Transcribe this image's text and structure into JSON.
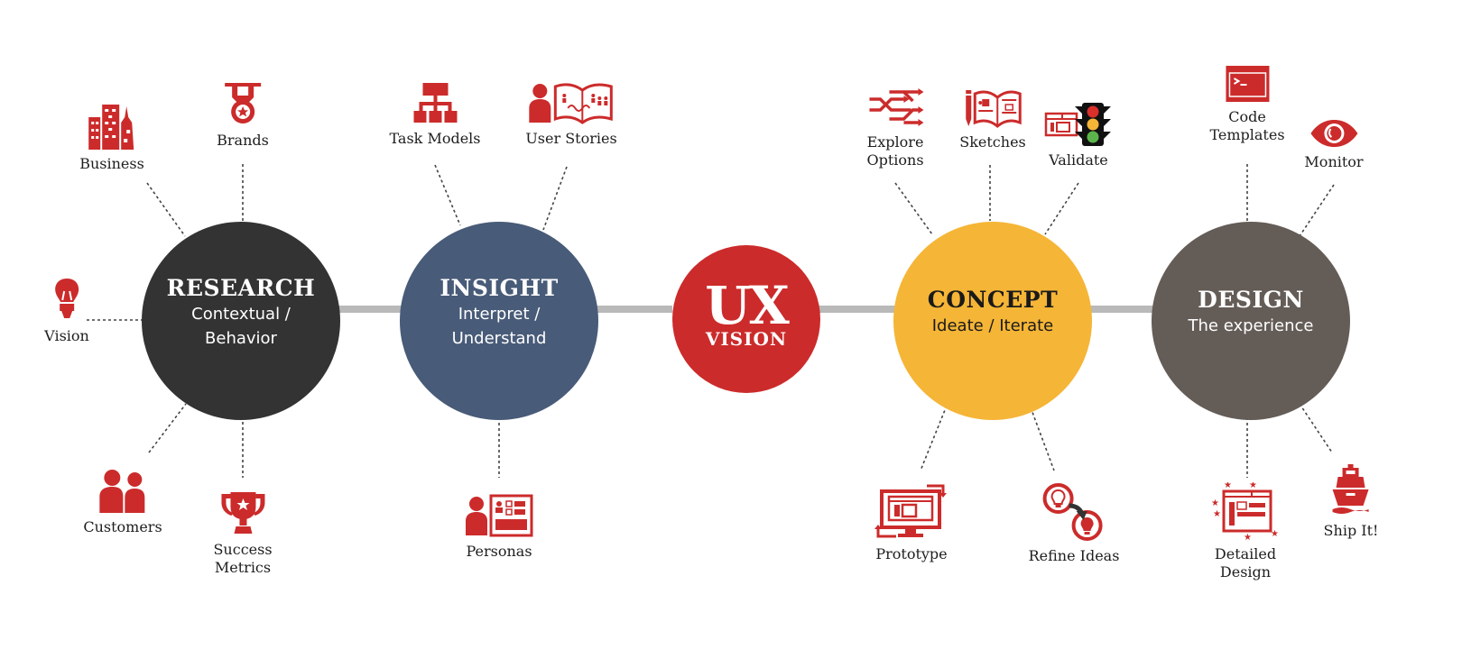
{
  "diagram": {
    "colors": {
      "accent_red": "#cc2b2b",
      "research": "#333333",
      "insight": "#485b78",
      "vision": "#cc2b2b",
      "concept": "#f5b536",
      "design": "#645c57",
      "connector": "#b9b9b9",
      "dotted": "#444444"
    },
    "center": {
      "main": "UX",
      "sub": "VISION"
    },
    "stages": [
      {
        "id": "research",
        "title": "RESEARCH",
        "subtitle_line1": "Contextual /",
        "subtitle_line2": "Behavior"
      },
      {
        "id": "insight",
        "title": "INSIGHT",
        "subtitle_line1": "Interpret /",
        "subtitle_line2": "Understand"
      },
      {
        "id": "concept",
        "title": "CONCEPT",
        "subtitle_line1": "Ideate / Iterate",
        "subtitle_line2": ""
      },
      {
        "id": "design",
        "title": "DESIGN",
        "subtitle_line1": "The experience",
        "subtitle_line2": ""
      }
    ],
    "items": {
      "business": {
        "label": "Business",
        "icon": "buildings-icon"
      },
      "brands": {
        "label": "Brands",
        "icon": "medal-icon"
      },
      "vision": {
        "label": "Vision",
        "icon": "lightbulb-icon"
      },
      "customers": {
        "label": "Customers",
        "icon": "people-icon"
      },
      "success_metrics": {
        "label_line1": "Success",
        "label_line2": "Metrics",
        "icon": "trophy-icon"
      },
      "task_models": {
        "label": "Task Models",
        "icon": "hierarchy-icon"
      },
      "user_stories": {
        "label": "User Stories",
        "icon": "storybook-icon"
      },
      "personas": {
        "label": "Personas",
        "icon": "persona-card-icon"
      },
      "explore_options": {
        "label_line1": "Explore",
        "label_line2": "Options",
        "icon": "shuffle-arrows-icon"
      },
      "sketches": {
        "label": "Sketches",
        "icon": "sketchbook-icon"
      },
      "validate": {
        "label": "Validate",
        "icon": "traffic-light-icon"
      },
      "prototype": {
        "label": "Prototype",
        "icon": "monitor-cycle-icon"
      },
      "refine_ideas": {
        "label": "Refine Ideas",
        "icon": "refine-bulbs-icon"
      },
      "code_templates": {
        "label_line1": "Code",
        "label_line2": "Templates",
        "icon": "terminal-window-icon"
      },
      "monitor": {
        "label": "Monitor",
        "icon": "eye-icon"
      },
      "detailed_design": {
        "label_line1": "Detailed",
        "label_line2": "Design",
        "icon": "wireframe-stars-icon"
      },
      "ship_it": {
        "label": "Ship It!",
        "icon": "ship-icon"
      }
    }
  }
}
